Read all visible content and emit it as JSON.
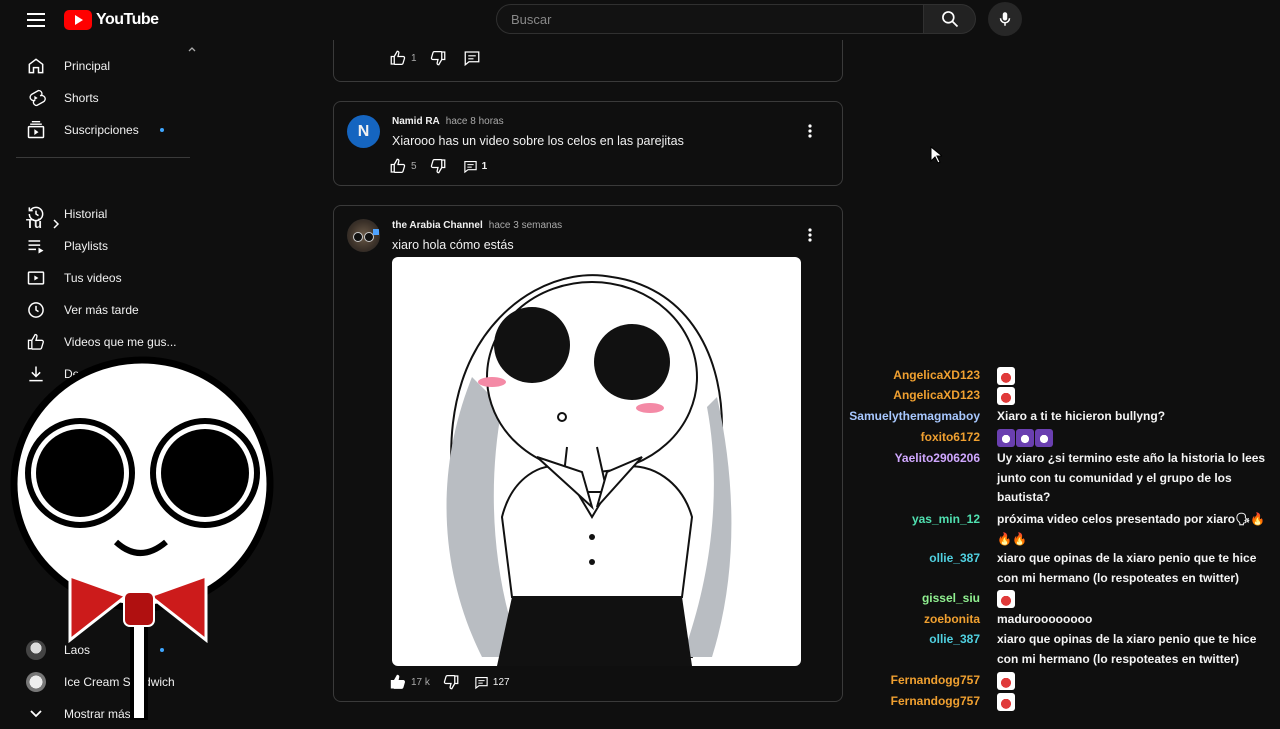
{
  "header": {
    "logo_text": "YouTube",
    "search_placeholder": "Buscar"
  },
  "sidebar": {
    "main": [
      {
        "label": "Principal",
        "icon": "home-icon"
      },
      {
        "label": "Shorts",
        "icon": "shorts-icon"
      },
      {
        "label": "Suscripciones",
        "icon": "subscriptions-icon"
      }
    ],
    "you_header": "Tú",
    "you_items": [
      {
        "label": "Historial",
        "icon": "history-icon"
      },
      {
        "label": "Playlists",
        "icon": "playlists-icon"
      },
      {
        "label": "Tus videos",
        "icon": "your-videos-icon"
      },
      {
        "label": "Ver más tarde",
        "icon": "watch-later-icon"
      },
      {
        "label": "Videos que me gus...",
        "icon": "like-icon"
      },
      {
        "label": "De",
        "icon": "download-icon"
      }
    ],
    "channels": [
      {
        "label": "Laos"
      },
      {
        "label": "Ice Cream Sandwich"
      }
    ],
    "show_more": "Mostrar más"
  },
  "comments": [
    {
      "likes": "1"
    },
    {
      "author": "Namid RA",
      "time": "hace 8 horas",
      "text": "Xiarooo has un video sobre los celos en las parejitas",
      "likes": "5",
      "replies": "1",
      "avatar_letter": "N"
    },
    {
      "author": "the Arabia Channel",
      "time": "hace 3 semanas",
      "text": "xiaro hola cómo estás",
      "likes": "17 k",
      "replies": "127"
    }
  ],
  "chat": [
    {
      "name": "AngelicaXD123",
      "color": "#f0a030",
      "msg": "",
      "emotes": 1
    },
    {
      "name": "AngelicaXD123",
      "color": "#f0a030",
      "msg": "",
      "emotes": 1
    },
    {
      "name": "Samuelythemagmaboy",
      "color": "#a8c8ff",
      "msg": "Xiaro a ti te hicieron bullyng?",
      "emotes": 0
    },
    {
      "name": "foxito6172",
      "color": "#f0a030",
      "msg": "",
      "emotes": 3
    },
    {
      "name": "Yaelito2906206",
      "color": "#d0a8ff",
      "msg": "Uy xiaro ¿si termino este año la historia lo lees junto con tu comunidad y el grupo de los bautista?",
      "emotes": 0
    },
    {
      "name": "yas_min_12",
      "color": "#50e0b0",
      "msg": "próxima video celos presentado por xiaro🗣🔥🔥🔥",
      "emotes": 0
    },
    {
      "name": "ollie_387",
      "color": "#50d0e0",
      "msg": "xiaro que opinas de la xiaro penio que te hice con mi hermano (lo respoteates en twitter)",
      "emotes": 0
    },
    {
      "name": "gissel_siu",
      "color": "#90f090",
      "msg": "",
      "emotes": 1
    },
    {
      "name": "zoebonita",
      "color": "#f0a030",
      "msg": "maduroooooooo",
      "emotes": 0
    },
    {
      "name": "ollie_387",
      "color": "#50d0e0",
      "msg": "xiaro que opinas de la xiaro penio que te hice con mi hermano (lo respoteates en twitter)",
      "emotes": 0
    },
    {
      "name": "Fernandogg757",
      "color": "#f0a030",
      "msg": "",
      "emotes": 1
    },
    {
      "name": "Fernandogg757",
      "color": "#f0a030",
      "msg": "",
      "emotes": 1
    }
  ],
  "colors": {
    "brand_red": "#ff0000",
    "link_blue": "#3ea6ff",
    "bg": "#0f0f0f"
  }
}
